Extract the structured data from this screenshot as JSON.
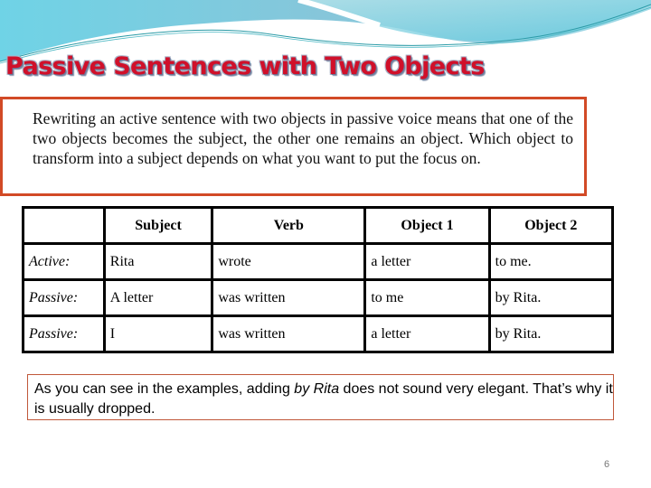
{
  "slide": {
    "title": "Passive Sentences with Two Objects",
    "intro": "Rewriting an active sentence with two objects in passive voice means that one of the two objects becomes the subject, the other one remains an object. Which object to transform into a subject depends on what you want to put the focus on.",
    "table": {
      "headers": [
        "",
        "Subject",
        "Verb",
        "Object 1",
        "Object 2"
      ],
      "rows": [
        [
          "Active:",
          "Rita",
          "wrote",
          "a letter",
          "to me."
        ],
        [
          "Passive:",
          "A letter",
          "was written",
          "to me",
          "by Rita."
        ],
        [
          "Passive:",
          "I",
          "was written",
          "a letter",
          "by Rita."
        ]
      ]
    },
    "note": {
      "before": "As you can see in the examples, adding ",
      "emphasis": "by Rita",
      "after": " does not sound very elegant. That’s why it is usually dropped."
    },
    "page_number": "6"
  },
  "colors": {
    "title": "#d0102a",
    "box_border": "#d24a26",
    "note_border": "#c0583a"
  }
}
